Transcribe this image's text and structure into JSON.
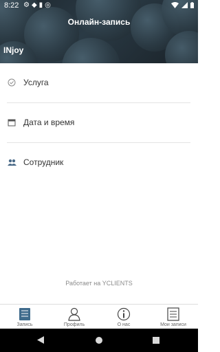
{
  "status": {
    "time": "8:22"
  },
  "header": {
    "title": "Онлайн-запись",
    "logo": "INjoy"
  },
  "menu": [
    {
      "label": "Услуга",
      "icon": "check-circle-icon"
    },
    {
      "label": "Дата и время",
      "icon": "calendar-icon"
    },
    {
      "label": "Сотрудник",
      "icon": "people-icon"
    }
  ],
  "powered_by": "Работает на YCLIENTS",
  "tabs": [
    {
      "label": "Запись",
      "icon": "book-icon"
    },
    {
      "label": "Профиль",
      "icon": "person-icon"
    },
    {
      "label": "О нас",
      "icon": "info-icon"
    },
    {
      "label": "Мои записи",
      "icon": "list-icon"
    }
  ],
  "colors": {
    "accent": "#3f6b8c",
    "header_dark": "#1d262d"
  }
}
